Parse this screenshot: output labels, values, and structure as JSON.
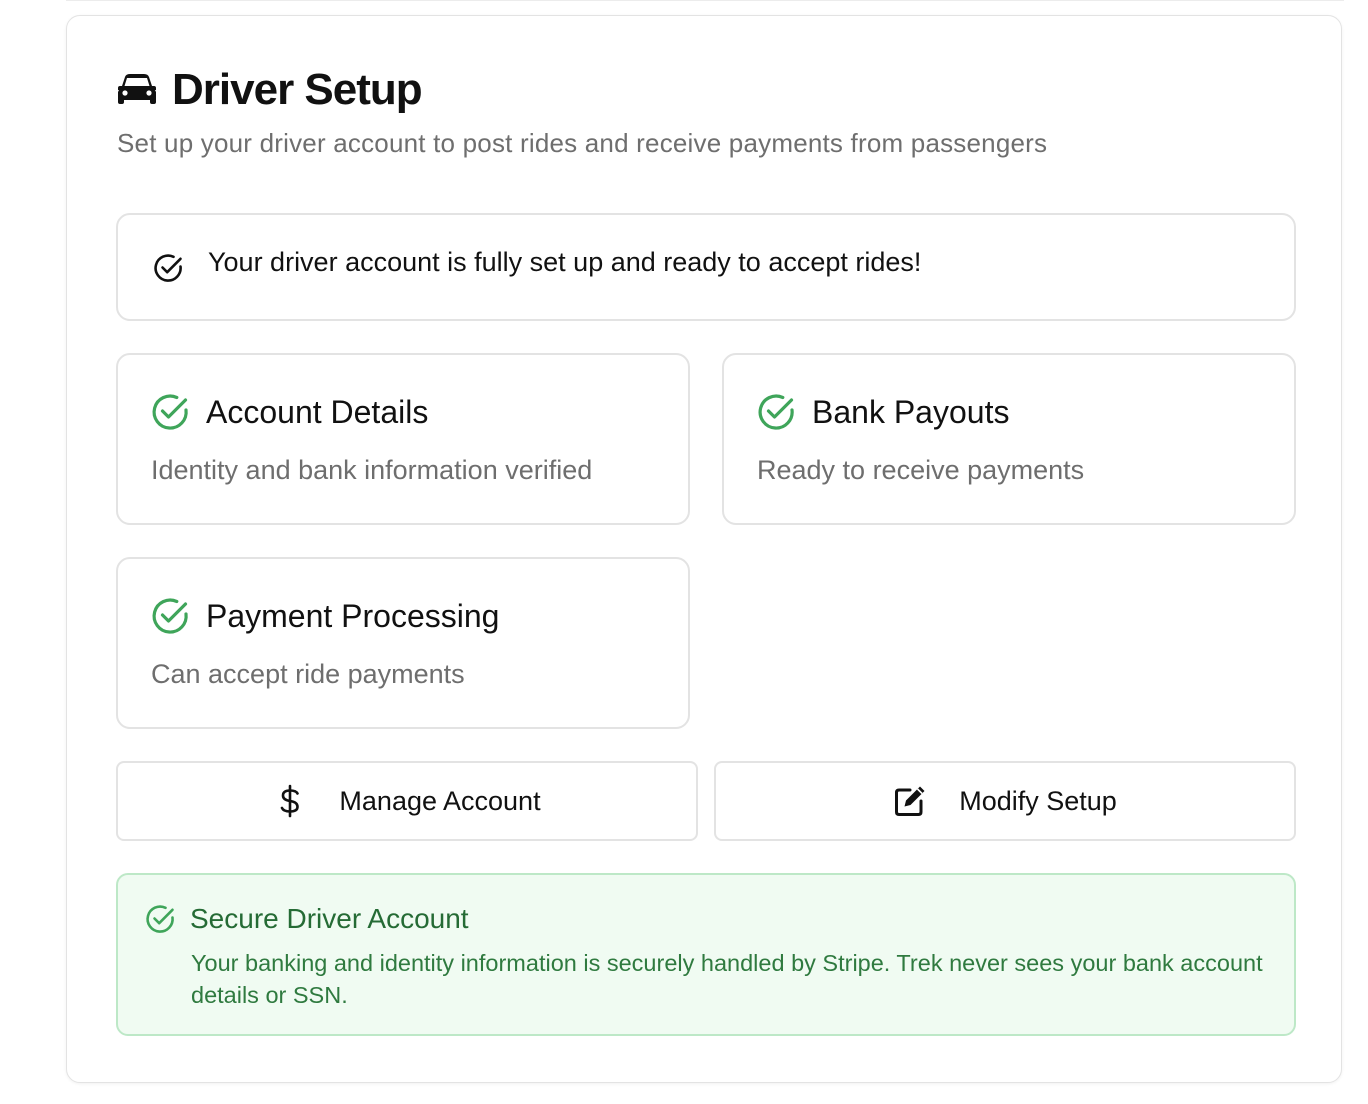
{
  "header": {
    "title": "Driver Setup",
    "subtitle": "Set up your driver account to post rides and receive payments from passengers",
    "icon": "car-icon"
  },
  "banner": {
    "icon": "check-circle-icon",
    "text": "Your driver account is fully set up and ready to accept rides!"
  },
  "status_cards": [
    {
      "icon": "check-circle-icon",
      "title": "Account Details",
      "description": "Identity and bank information verified"
    },
    {
      "icon": "check-circle-icon",
      "title": "Bank Payouts",
      "description": "Ready to receive payments"
    },
    {
      "icon": "check-circle-icon",
      "title": "Payment Processing",
      "description": "Can accept ride payments"
    }
  ],
  "actions": {
    "manage": {
      "icon": "dollar-icon",
      "label": "Manage Account"
    },
    "modify": {
      "icon": "edit-icon",
      "label": "Modify Setup"
    }
  },
  "secure_notice": {
    "icon": "check-circle-icon",
    "title": "Secure Driver Account",
    "body": "Your banking and identity information is securely handled by Stripe. Trek never sees your bank account details or SSN."
  },
  "colors": {
    "success_green": "#3fa55a",
    "notice_bg": "#f0fbf2",
    "notice_border": "#bde8c7",
    "notice_text": "#2f7a3f",
    "muted_text": "#6e6e6e",
    "border": "#e3e3e3"
  }
}
